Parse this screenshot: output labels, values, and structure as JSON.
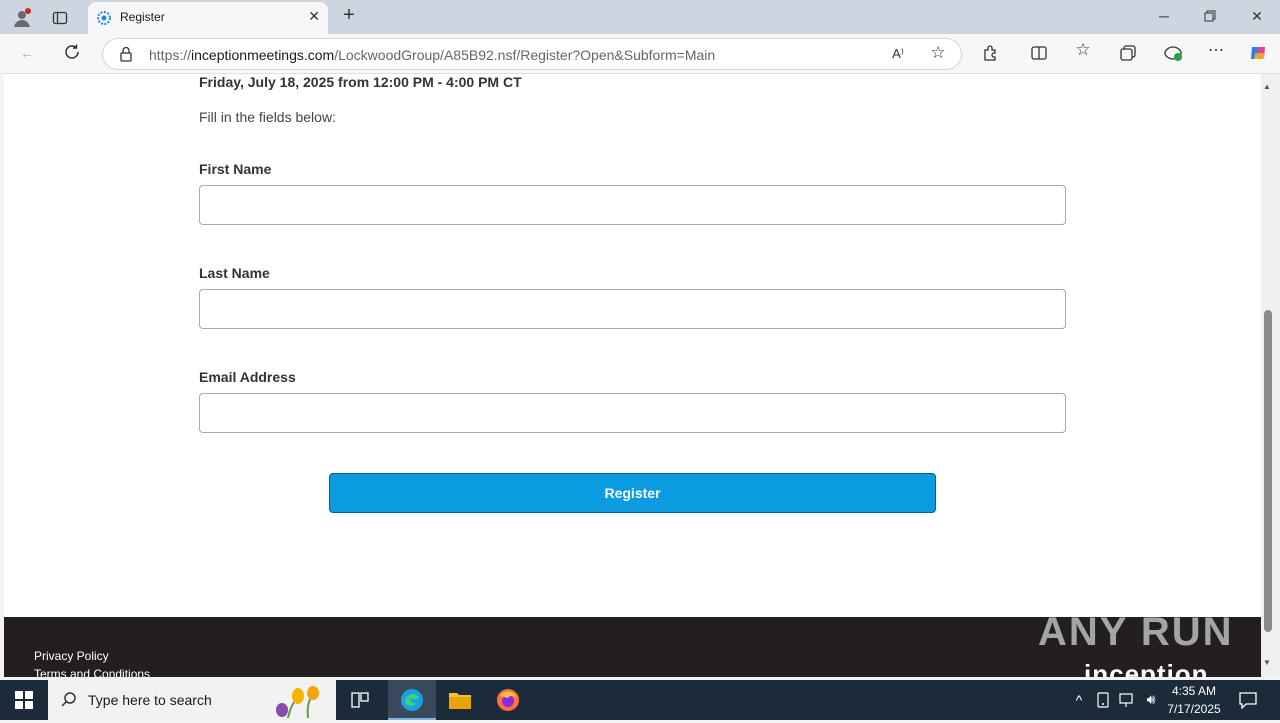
{
  "browser": {
    "tab_title": "Register",
    "url_prefix": "https://",
    "url_host": "inceptionmeetings.com",
    "url_path": "/LockwoodGroup/A85B92.nsf/Register?Open&Subform=Main"
  },
  "page": {
    "event_date": "Friday, July 18, 2025 from 12:00 PM - 4:00 PM CT",
    "instructions": "Fill in the fields below:",
    "fields": [
      {
        "label": "First Name",
        "value": ""
      },
      {
        "label": "Last Name",
        "value": ""
      },
      {
        "label": "Email Address",
        "value": ""
      }
    ],
    "register_label": "Register",
    "footer_links": [
      "Privacy Policy",
      "Terms and Conditions"
    ],
    "footer_logo": "inception",
    "accent_color": "#0b9be0"
  },
  "watermark": "ANY RUN",
  "taskbar": {
    "search_placeholder": "Type here to search",
    "time": "4:35 AM",
    "date": "7/17/2025"
  }
}
